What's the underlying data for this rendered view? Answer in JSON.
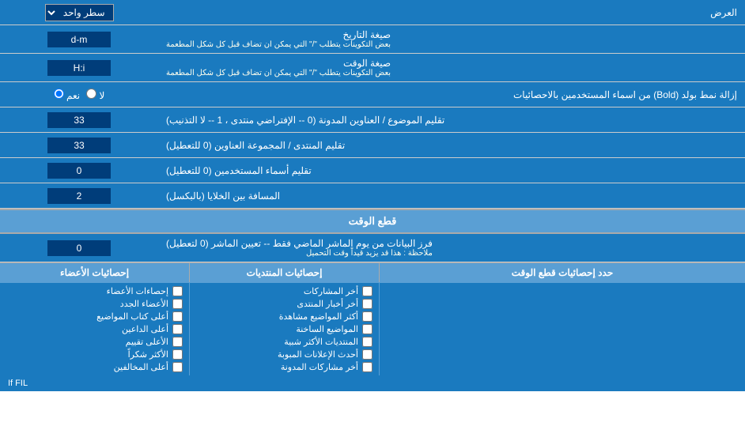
{
  "title": "العرض",
  "topDropdown": {
    "label": "العرض",
    "options": [
      "سطر واحد"
    ],
    "selectedOption": "سطر واحد"
  },
  "dateFormat": {
    "label": "صيغة التاريخ",
    "sublabel": "بعض التكوينات يتطلب \"/\" التي يمكن ان تضاف قبل كل شكل المطعمة",
    "value": "d-m"
  },
  "timeFormat": {
    "label": "صيغة الوقت",
    "sublabel": "بعض التكوينات يتطلب \"/\" التي يمكن ان تضاف قبل كل شكل المطعمة",
    "value": "H:i"
  },
  "boldRemove": {
    "label": "إزالة نمط بولد (Bold) من اسماء المستخدمين بالاحصائيات",
    "options": [
      "نعم",
      "لا"
    ],
    "selected": "نعم"
  },
  "titleTrim": {
    "label": "تقليم الموضوع / العناوين المدونة (0 -- الإفتراضي منتدى ، 1 -- لا التذنيب)",
    "value": "33"
  },
  "forumTrim": {
    "label": "تقليم المنتدى / المجموعة العناوين (0 للتعطيل)",
    "value": "33"
  },
  "usersTrim": {
    "label": "تقليم أسماء المستخدمين (0 للتعطيل)",
    "value": "0"
  },
  "cellPadding": {
    "label": "المسافة بين الخلايا (بالبكسل)",
    "value": "2"
  },
  "cutoffSection": {
    "title": "قطع الوقت"
  },
  "cutoffDays": {
    "label": "فرز البيانات من يوم الماشر الماضي فقط -- تعيين الماشر (0 لتعطيل)",
    "note": "ملاحظة : هذا قد يزيد قيداً وقت التحميل",
    "value": "0"
  },
  "statsSection": {
    "label": "حدد إحصائيات قطع الوقت"
  },
  "col1Header": "إحصائيات الأعضاء",
  "col2Header": "إحصائيات المنتديات",
  "col3Header": "",
  "col1Items": [
    {
      "label": "الأعضاء الجدد",
      "checked": false
    },
    {
      "label": "أعلى كتاب المواضيع",
      "checked": false
    },
    {
      "label": "أعلى الداعين",
      "checked": false
    },
    {
      "label": "الأعلى تقييم",
      "checked": false
    },
    {
      "label": "الأكثر شكراً",
      "checked": false
    },
    {
      "label": "أعلى المخالفين",
      "checked": false
    }
  ],
  "col2Items": [
    {
      "label": "أخر المشاركات",
      "checked": false
    },
    {
      "label": "أخر أخبار المنتدى",
      "checked": false
    },
    {
      "label": "أكثر المواضيع مشاهدة",
      "checked": false
    },
    {
      "label": "المواضيع الساخنة",
      "checked": false
    },
    {
      "label": "المنتديات الأكثر شبية",
      "checked": false
    },
    {
      "label": "أحدث الإعلانات المبوبة",
      "checked": false
    },
    {
      "label": "أخر مشاركات المدونة",
      "checked": false
    }
  ],
  "col3Items": [
    {
      "label": "إحصاءات الأعضاء",
      "checked": false
    }
  ],
  "ifFILText": "If FIL"
}
